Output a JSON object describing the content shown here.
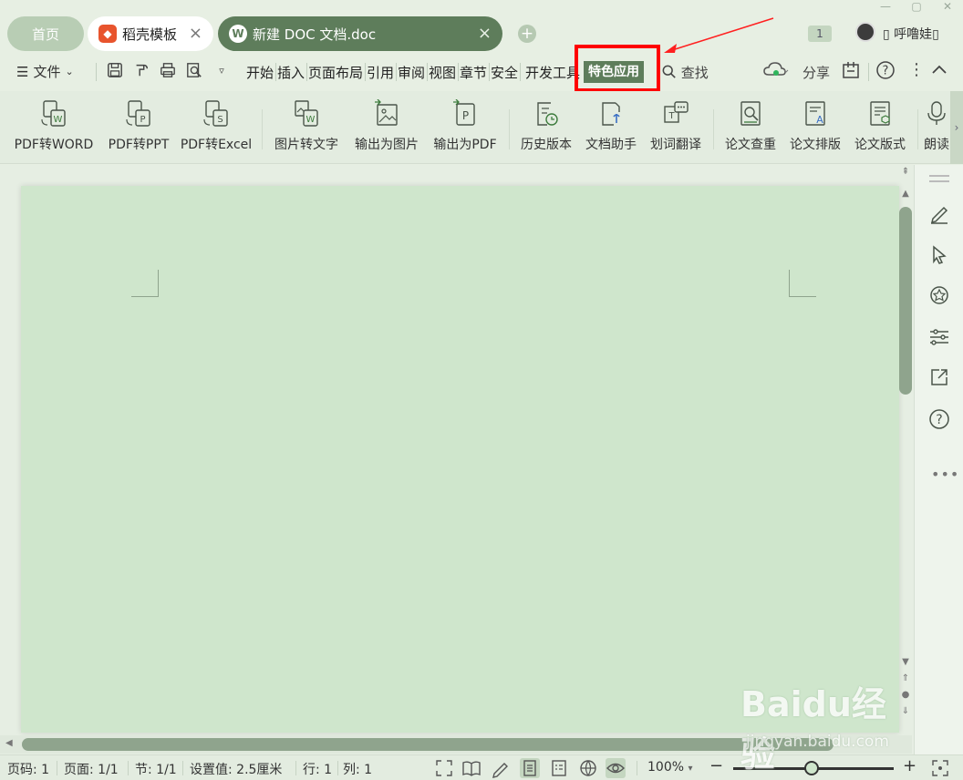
{
  "tabs": {
    "home": "首页",
    "template": "稻壳模板",
    "document": "新建 DOC 文档.doc"
  },
  "window": {
    "notify_count": "1",
    "user_name": "▯ 呼噜娃▯"
  },
  "menubar": {
    "file": "文件",
    "tabs": [
      "开始",
      "插入",
      "页面布局",
      "引用",
      "审阅",
      "视图",
      "章节",
      "安全",
      "开发工具"
    ],
    "active_tab": "特色应用",
    "search": "查找",
    "share": "分享"
  },
  "ribbon": {
    "buttons": [
      {
        "label": "PDF转WORD",
        "icon": "pdf-to-word-icon"
      },
      {
        "label": "PDF转PPT",
        "icon": "pdf-to-ppt-icon"
      },
      {
        "label": "PDF转Excel",
        "icon": "pdf-to-excel-icon"
      },
      {
        "label": "图片转文字",
        "icon": "image-to-text-icon"
      },
      {
        "label": "输出为图片",
        "icon": "export-image-icon"
      },
      {
        "label": "输出为PDF",
        "icon": "export-pdf-icon"
      },
      {
        "label": "历史版本",
        "icon": "history-version-icon"
      },
      {
        "label": "文档助手",
        "icon": "doc-assistant-icon"
      },
      {
        "label": "划词翻译",
        "icon": "translate-icon"
      },
      {
        "label": "论文查重",
        "icon": "paper-check-icon"
      },
      {
        "label": "论文排版",
        "icon": "paper-layout-icon"
      },
      {
        "label": "论文版式",
        "icon": "paper-format-icon"
      },
      {
        "label": "朗读",
        "icon": "read-aloud-icon"
      }
    ]
  },
  "statusbar": {
    "page_code": "页码: 1",
    "page": "页面: 1/1",
    "section": "节: 1/1",
    "setting": "设置值: 2.5厘米",
    "row": "行: 1",
    "col": "列: 1",
    "zoom": "100%",
    "zoom_level_fraction": 0.49
  },
  "watermark": {
    "brand": "Baidu经验",
    "url": "jingyan.baidu.com"
  },
  "colors": {
    "accent": "#5e7d5b",
    "page_background": "#cfe6cc",
    "highlight": "#ff0000"
  }
}
